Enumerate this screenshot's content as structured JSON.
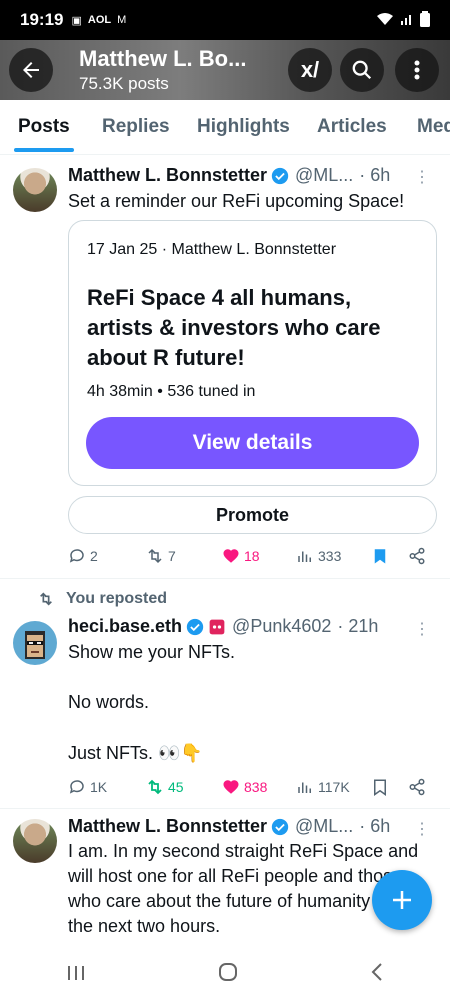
{
  "status_bar": {
    "time": "19:19",
    "carrier_label": "AOL"
  },
  "header": {
    "title": "Matthew L. Bo...",
    "post_count": "75.3K posts"
  },
  "tabs": [
    {
      "label": "Posts",
      "active": true
    },
    {
      "label": "Replies",
      "active": false
    },
    {
      "label": "Highlights",
      "active": false
    },
    {
      "label": "Articles",
      "active": false
    },
    {
      "label": "Med",
      "active": false
    }
  ],
  "posts": [
    {
      "name": "Matthew L. Bonnstetter",
      "handle": "@ML...",
      "time": "· 6h",
      "text": "Set a reminder our ReFi upcoming Space!",
      "space": {
        "meta": "17 Jan 25 · Matthew L. Bonnstetter",
        "title": "ReFi Space 4 all humans, artists & investors who care about R future!",
        "stats": "4h 38min • 536 tuned in",
        "button": "View details"
      },
      "promote": "Promote",
      "replies": "2",
      "reposts": "7",
      "likes": "18",
      "views": "333"
    },
    {
      "reposted_label": "You reposted",
      "name": "heci.base.eth",
      "handle": "@Punk4602",
      "time": "· 21h",
      "text_lines": [
        "Show me your NFTs.",
        "No words.",
        "Just NFTs. 👀👇"
      ],
      "replies": "1K",
      "reposts": "45",
      "likes": "838",
      "views": "117K"
    },
    {
      "name": "Matthew L. Bonnstetter",
      "handle": "@ML...",
      "time": "· 6h",
      "text": "I am.  In my second straight ReFi Space and will host one for all ReFi people and those who care about the future of humanity within the next two hours."
    }
  ],
  "colors": {
    "accent": "#1d9bf0",
    "space_purple": "#7856ff",
    "like_pink": "#f91880",
    "repost_green": "#00ba7c"
  }
}
